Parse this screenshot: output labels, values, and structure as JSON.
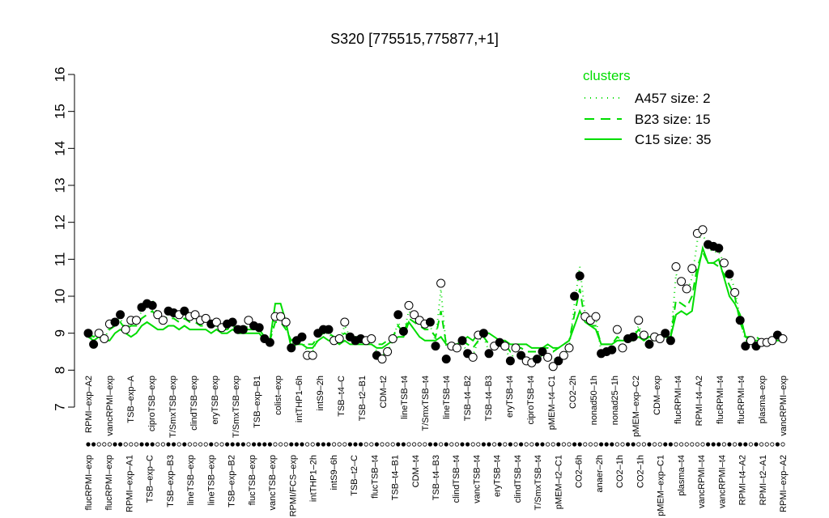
{
  "chart_data": {
    "type": "line",
    "title": "S320 [775515,775877,+1]",
    "xlabel": "",
    "ylabel": "",
    "ylim": [
      7,
      16
    ],
    "yticks": [
      7,
      8,
      9,
      10,
      11,
      12,
      13,
      14,
      15,
      16
    ],
    "grid": false,
    "legend": {
      "title": "clusters",
      "placement": "top-right",
      "color": "#00dd00",
      "entries": [
        {
          "label": "A457 size: 2",
          "dash": "dotted"
        },
        {
          "label": "B23 size: 15",
          "dash": "dashed"
        },
        {
          "label": "C15 size: 35",
          "dash": "solid"
        }
      ]
    },
    "x_labels_top": [
      "RPMI–exp–A2",
      "vancRPMI–exp",
      "TSB–exp–A",
      "ciproTSB–exp",
      "T/SmxTSB–exp",
      "clindTSB–exp",
      "eryTSB–exp",
      "T/SmxTSB–exp",
      "TSB–exp–B1",
      "colist–exp",
      "intTHP1–6h",
      "intS9–2h",
      "TSB–t4–C",
      "TSB–t2–B1",
      "CDM–t2",
      "lineTSB–t4",
      "T/SmxTSB–t4",
      "lineTSB–t4",
      "TSB–t4–B2",
      "TSB–t4–B3",
      "eryTSB–t4",
      "ciproTSB–t4",
      "pMEM–t4–C1",
      "CO2–2h",
      "nonad50–1h",
      "nonad25–1h",
      "pMEM–exp–C2",
      "CDM–exp",
      "flucRPMI–t4",
      "RPMI–t4–A2",
      "flucRPMI–t4",
      "flucRPMI–t4",
      "plasma–exp",
      "vancRPMI–exp"
    ],
    "x_labels_bottom": [
      "flucRPMI–exp",
      "flucRPMI–exp",
      "RPMI–exp–A1",
      "TSB–exp–C",
      "TSB–exp–B3",
      "lineTSB–exp",
      "lineTSB–exp",
      "TSB–exp–B2",
      "flucTSB–exp",
      "vancTSB–exp",
      "RPMI/FCS–exp",
      "intTHP1–2h",
      "intS9–6h",
      "TSB–t2–C",
      "flucTSB–t4",
      "TSB–t4–B1",
      "CDM–t4",
      "TSB–t4–B3",
      "clindTSB–t4",
      "vancTSB–t4",
      "eryTSB–t4",
      "clindTSB–t4",
      "T/SmxTSB–t4",
      "pMEM–t2–C1",
      "CO2–6h",
      "anaer–2h",
      "CO2–1h",
      "CO2–1h",
      "pMEM–exp–C1",
      "plasma–t4",
      "vancRPMI–t4",
      "vancRPMI–t4",
      "RPMI–t4–A2",
      "RPMI–t2–A1",
      "RPMI–exp–A2"
    ],
    "points": [
      {
        "y": 9.0,
        "filled": true
      },
      {
        "y": 8.7,
        "filled": true
      },
      {
        "y": 9.0,
        "filled": false
      },
      {
        "y": 8.85,
        "filled": false
      },
      {
        "y": 9.25,
        "filled": false
      },
      {
        "y": 9.3,
        "filled": true
      },
      {
        "y": 9.5,
        "filled": true
      },
      {
        "y": 9.1,
        "filled": false
      },
      {
        "y": 9.35,
        "filled": false
      },
      {
        "y": 9.35,
        "filled": false
      },
      {
        "y": 9.7,
        "filled": true
      },
      {
        "y": 9.8,
        "filled": true
      },
      {
        "y": 9.75,
        "filled": true
      },
      {
        "y": 9.5,
        "filled": false
      },
      {
        "y": 9.35,
        "filled": false
      },
      {
        "y": 9.6,
        "filled": true
      },
      {
        "y": 9.55,
        "filled": true
      },
      {
        "y": 9.5,
        "filled": false
      },
      {
        "y": 9.6,
        "filled": true
      },
      {
        "y": 9.45,
        "filled": false
      },
      {
        "y": 9.5,
        "filled": false
      },
      {
        "y": 9.35,
        "filled": false
      },
      {
        "y": 9.4,
        "filled": false
      },
      {
        "y": 9.25,
        "filled": true
      },
      {
        "y": 9.3,
        "filled": false
      },
      {
        "y": 9.15,
        "filled": false
      },
      {
        "y": 9.25,
        "filled": true
      },
      {
        "y": 9.3,
        "filled": true
      },
      {
        "y": 9.1,
        "filled": true
      },
      {
        "y": 9.1,
        "filled": true
      },
      {
        "y": 9.35,
        "filled": false
      },
      {
        "y": 9.2,
        "filled": true
      },
      {
        "y": 9.15,
        "filled": true
      },
      {
        "y": 8.85,
        "filled": true
      },
      {
        "y": 8.75,
        "filled": true
      },
      {
        "y": 9.45,
        "filled": false
      },
      {
        "y": 9.45,
        "filled": false
      },
      {
        "y": 9.3,
        "filled": false
      },
      {
        "y": 8.6,
        "filled": true
      },
      {
        "y": 8.8,
        "filled": true
      },
      {
        "y": 8.9,
        "filled": true
      },
      {
        "y": 8.4,
        "filled": false
      },
      {
        "y": 8.4,
        "filled": false
      },
      {
        "y": 9.0,
        "filled": true
      },
      {
        "y": 9.1,
        "filled": true
      },
      {
        "y": 9.1,
        "filled": true
      },
      {
        "y": 8.8,
        "filled": false
      },
      {
        "y": 8.85,
        "filled": false
      },
      {
        "y": 9.3,
        "filled": false
      },
      {
        "y": 8.9,
        "filled": true
      },
      {
        "y": 8.8,
        "filled": true
      },
      {
        "y": 8.85,
        "filled": true
      },
      {
        "y": 8.8,
        "filled": false
      },
      {
        "y": 8.85,
        "filled": false
      },
      {
        "y": 8.4,
        "filled": true
      },
      {
        "y": 8.3,
        "filled": false
      },
      {
        "y": 8.5,
        "filled": false
      },
      {
        "y": 8.85,
        "filled": false
      },
      {
        "y": 9.5,
        "filled": true
      },
      {
        "y": 9.05,
        "filled": true
      },
      {
        "y": 9.75,
        "filled": false
      },
      {
        "y": 9.5,
        "filled": false
      },
      {
        "y": 9.35,
        "filled": false
      },
      {
        "y": 9.25,
        "filled": false
      },
      {
        "y": 9.3,
        "filled": true
      },
      {
        "y": 8.65,
        "filled": true
      },
      {
        "y": 10.35,
        "filled": false
      },
      {
        "y": 8.3,
        "filled": true
      },
      {
        "y": 8.65,
        "filled": false
      },
      {
        "y": 8.6,
        "filled": false
      },
      {
        "y": 8.8,
        "filled": true
      },
      {
        "y": 8.45,
        "filled": true
      },
      {
        "y": 8.35,
        "filled": false
      },
      {
        "y": 8.95,
        "filled": false
      },
      {
        "y": 9.0,
        "filled": true
      },
      {
        "y": 8.45,
        "filled": true
      },
      {
        "y": 8.65,
        "filled": false
      },
      {
        "y": 8.75,
        "filled": true
      },
      {
        "y": 8.65,
        "filled": false
      },
      {
        "y": 8.25,
        "filled": true
      },
      {
        "y": 8.6,
        "filled": false
      },
      {
        "y": 8.4,
        "filled": true
      },
      {
        "y": 8.25,
        "filled": false
      },
      {
        "y": 8.2,
        "filled": false
      },
      {
        "y": 8.3,
        "filled": true
      },
      {
        "y": 8.5,
        "filled": true
      },
      {
        "y": 8.35,
        "filled": false
      },
      {
        "y": 8.1,
        "filled": false
      },
      {
        "y": 8.25,
        "filled": true
      },
      {
        "y": 8.4,
        "filled": false
      },
      {
        "y": 8.6,
        "filled": false
      },
      {
        "y": 10.0,
        "filled": true
      },
      {
        "y": 10.55,
        "filled": true
      },
      {
        "y": 9.45,
        "filled": false
      },
      {
        "y": 9.35,
        "filled": false
      },
      {
        "y": 9.45,
        "filled": false
      },
      {
        "y": 8.45,
        "filled": true
      },
      {
        "y": 8.5,
        "filled": true
      },
      {
        "y": 8.55,
        "filled": true
      },
      {
        "y": 9.1,
        "filled": false
      },
      {
        "y": 8.6,
        "filled": false
      },
      {
        "y": 8.85,
        "filled": true
      },
      {
        "y": 8.9,
        "filled": true
      },
      {
        "y": 9.35,
        "filled": false
      },
      {
        "y": 8.95,
        "filled": false
      },
      {
        "y": 8.7,
        "filled": true
      },
      {
        "y": 8.9,
        "filled": false
      },
      {
        "y": 8.85,
        "filled": false
      },
      {
        "y": 9.0,
        "filled": true
      },
      {
        "y": 8.8,
        "filled": true
      },
      {
        "y": 10.8,
        "filled": false
      },
      {
        "y": 10.4,
        "filled": false
      },
      {
        "y": 10.2,
        "filled": false
      },
      {
        "y": 10.75,
        "filled": false
      },
      {
        "y": 11.7,
        "filled": false
      },
      {
        "y": 11.8,
        "filled": false
      },
      {
        "y": 11.4,
        "filled": true
      },
      {
        "y": 11.35,
        "filled": true
      },
      {
        "y": 11.3,
        "filled": true
      },
      {
        "y": 10.9,
        "filled": false
      },
      {
        "y": 10.6,
        "filled": true
      },
      {
        "y": 10.1,
        "filled": false
      },
      {
        "y": 9.35,
        "filled": true
      },
      {
        "y": 8.65,
        "filled": true
      },
      {
        "y": 8.8,
        "filled": false
      },
      {
        "y": 8.65,
        "filled": true
      },
      {
        "y": 8.75,
        "filled": false
      },
      {
        "y": 8.75,
        "filled": false
      },
      {
        "y": 8.8,
        "filled": false
      },
      {
        "y": 8.95,
        "filled": true
      },
      {
        "y": 8.85,
        "filled": false
      }
    ],
    "series": [
      {
        "dash": "dotted",
        "values": [
          9.0,
          8.8,
          9.0,
          8.8,
          9.2,
          9.3,
          9.4,
          9.1,
          9.3,
          9.3,
          9.6,
          9.7,
          9.9,
          9.5,
          9.3,
          9.5,
          9.5,
          9.4,
          9.5,
          9.4,
          9.4,
          9.3,
          9.3,
          9.2,
          9.2,
          9.1,
          9.2,
          9.2,
          9.1,
          9.1,
          9.2,
          9.1,
          9.1,
          8.9,
          8.8,
          9.5,
          9.4,
          9.2,
          8.7,
          8.8,
          8.8,
          8.5,
          8.5,
          8.9,
          9.0,
          9.0,
          8.8,
          8.8,
          9.2,
          8.9,
          8.8,
          8.8,
          8.8,
          8.8,
          8.5,
          8.4,
          8.5,
          8.8,
          9.3,
          9.0,
          9.6,
          9.4,
          9.3,
          9.2,
          9.2,
          8.8,
          10.2,
          8.6,
          8.6,
          8.6,
          8.7,
          8.5,
          8.4,
          8.8,
          8.9,
          8.5,
          8.6,
          8.6,
          8.6,
          8.3,
          8.5,
          8.4,
          8.3,
          8.3,
          8.3,
          8.4,
          8.4,
          8.3,
          8.3,
          8.4,
          8.6,
          9.8,
          10.8,
          9.5,
          9.4,
          9.4,
          8.5,
          8.6,
          8.6,
          8.9,
          8.7,
          8.8,
          8.9,
          9.2,
          8.9,
          8.8,
          8.8,
          8.8,
          8.9,
          8.8,
          10.6,
          10.3,
          10.1,
          10.5,
          11.5,
          11.7,
          11.3,
          11.2,
          11.2,
          10.9,
          10.6,
          10.2,
          9.4,
          8.8,
          8.8,
          8.7,
          8.7,
          8.7,
          8.8,
          8.9,
          8.8
        ]
      },
      {
        "dash": "dashed",
        "values": [
          9.0,
          8.9,
          9.0,
          8.9,
          9.1,
          9.2,
          9.3,
          9.1,
          9.2,
          9.2,
          9.4,
          9.5,
          9.6,
          9.4,
          9.3,
          9.4,
          9.4,
          9.3,
          9.4,
          9.3,
          9.3,
          9.2,
          9.2,
          9.2,
          9.2,
          9.1,
          9.1,
          9.2,
          9.1,
          9.1,
          9.1,
          9.1,
          9.1,
          8.9,
          8.8,
          9.3,
          9.3,
          9.1,
          8.8,
          8.9,
          8.9,
          8.7,
          8.7,
          8.9,
          9.0,
          9.0,
          8.9,
          8.9,
          9.0,
          8.9,
          8.9,
          8.9,
          8.9,
          8.9,
          8.7,
          8.7,
          8.8,
          8.9,
          9.2,
          9.0,
          9.4,
          9.3,
          9.2,
          9.1,
          9.1,
          8.9,
          9.6,
          8.7,
          8.7,
          8.7,
          8.8,
          8.7,
          8.6,
          8.8,
          8.9,
          8.7,
          8.7,
          8.7,
          8.7,
          8.5,
          8.6,
          8.6,
          8.5,
          8.5,
          8.5,
          8.6,
          8.6,
          8.5,
          8.6,
          8.7,
          8.8,
          9.5,
          10.2,
          9.3,
          9.2,
          9.2,
          8.7,
          8.7,
          8.7,
          8.9,
          8.8,
          8.8,
          8.9,
          9.1,
          8.9,
          8.9,
          8.9,
          8.9,
          8.9,
          8.9,
          9.9,
          9.8,
          9.7,
          10.0,
          10.8,
          11.2,
          10.9,
          10.9,
          10.8,
          10.6,
          10.3,
          10.0,
          9.3,
          8.9,
          8.9,
          8.9,
          8.8,
          8.8,
          8.8,
          8.9,
          8.9
        ]
      },
      {
        "dash": "solid",
        "values": [
          8.9,
          8.8,
          8.9,
          8.8,
          8.8,
          9.0,
          9.1,
          9.0,
          8.9,
          9.0,
          9.2,
          9.3,
          9.2,
          9.1,
          9.1,
          9.2,
          9.2,
          9.1,
          9.2,
          9.1,
          9.1,
          9.1,
          9.1,
          9.0,
          9.1,
          9.0,
          9.0,
          9.1,
          9.0,
          9.0,
          9.0,
          9.0,
          9.0,
          8.8,
          8.8,
          9.8,
          9.8,
          9.3,
          8.6,
          8.7,
          8.7,
          8.6,
          8.6,
          8.8,
          8.9,
          8.8,
          8.8,
          8.7,
          8.8,
          8.7,
          8.7,
          8.7,
          8.7,
          8.7,
          8.6,
          8.6,
          8.7,
          8.8,
          8.9,
          8.9,
          9.3,
          9.1,
          8.9,
          8.8,
          8.8,
          8.8,
          8.9,
          8.7,
          8.7,
          8.7,
          8.8,
          8.9,
          8.8,
          9.0,
          9.0,
          9.0,
          8.9,
          8.8,
          8.8,
          8.7,
          8.7,
          8.7,
          8.7,
          8.6,
          8.6,
          8.6,
          8.7,
          8.6,
          8.6,
          8.7,
          8.8,
          9.2,
          9.6,
          9.3,
          9.2,
          9.1,
          8.7,
          8.7,
          8.7,
          8.8,
          8.8,
          8.8,
          8.8,
          8.9,
          8.8,
          8.9,
          8.9,
          8.9,
          8.9,
          8.9,
          9.5,
          9.6,
          9.5,
          9.6,
          10.6,
          11.3,
          10.9,
          10.9,
          11.0,
          10.5,
          10.0,
          9.8,
          9.5,
          8.9,
          8.8,
          8.8,
          8.8,
          8.8,
          8.8,
          8.8,
          8.8
        ]
      }
    ]
  }
}
